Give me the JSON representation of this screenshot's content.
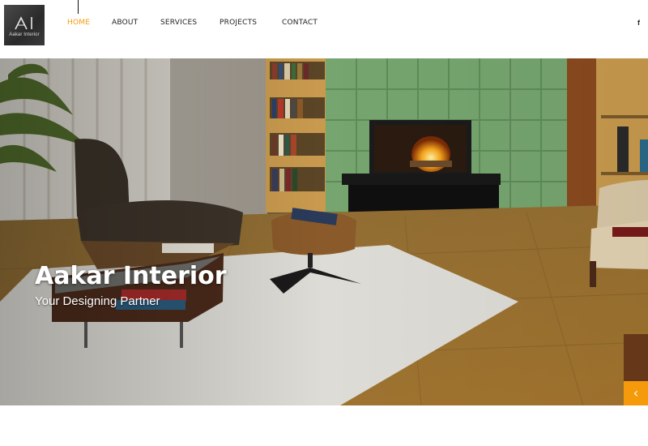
{
  "brand": {
    "logo_text": "Aakar Interior",
    "logo_mark": "AI"
  },
  "nav": {
    "items": [
      {
        "label": "HOME",
        "active": true
      },
      {
        "label": "ABOUT",
        "active": false
      },
      {
        "label": "SERVICES",
        "active": false
      },
      {
        "label": "PROJECTS",
        "active": false
      },
      {
        "label": "CONTACT",
        "active": false
      }
    ]
  },
  "social": {
    "facebook_glyph": "f",
    "icon": "facebook-icon"
  },
  "hero": {
    "title": "Aakar Interior",
    "subtitle": "Your Designing Partner",
    "prev_glyph": "‹",
    "prev_icon": "chevron-left-icon"
  },
  "colors": {
    "accent": "#f59a0b",
    "nav_text": "#222222"
  }
}
